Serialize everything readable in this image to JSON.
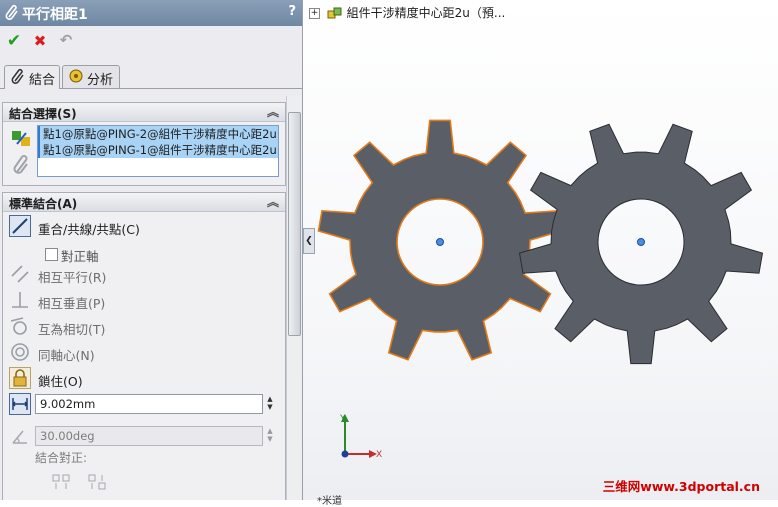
{
  "property_manager": {
    "title": "平行相距1",
    "help": "?",
    "toolbar": {
      "ok": "✔",
      "cancel": "✖",
      "undo": "↶"
    },
    "tabs": [
      {
        "label": "結合",
        "icon": "paperclip-icon"
      },
      {
        "label": "分析",
        "icon": "analysis-icon"
      }
    ],
    "mate_selections": {
      "header": "結合選擇(S)",
      "items": [
        "點1@原點@PING-2@組件干涉精度中心距2u",
        "點1@原點@PING-1@組件干涉精度中心距2u"
      ]
    },
    "standard_mates": {
      "header": "標準結合(A)",
      "coincident": "重合/共線/共點(C)",
      "align_axis": "對正軸",
      "parallel": "相互平行(R)",
      "perpendicular": "相互垂直(P)",
      "tangent": "互為相切(T)",
      "concentric": "同軸心(N)",
      "lock": "鎖住(O)",
      "distance_value": "9.002mm",
      "angle_value": "30.00deg",
      "mate_alignment": "結合對正:"
    }
  },
  "viewport": {
    "tree_node": "組件干涉精度中心距2u（預...",
    "triad": {
      "x": "X",
      "y": "Y"
    },
    "bottom_label": "*米道",
    "watermark": "三维网www.3dportal.cn"
  },
  "colors": {
    "gear_fill": "#5a5e66",
    "gear_selected_edge": "#e07a1a",
    "gear_edge": "#2a2d33",
    "title_bar": "#7d93ad"
  }
}
